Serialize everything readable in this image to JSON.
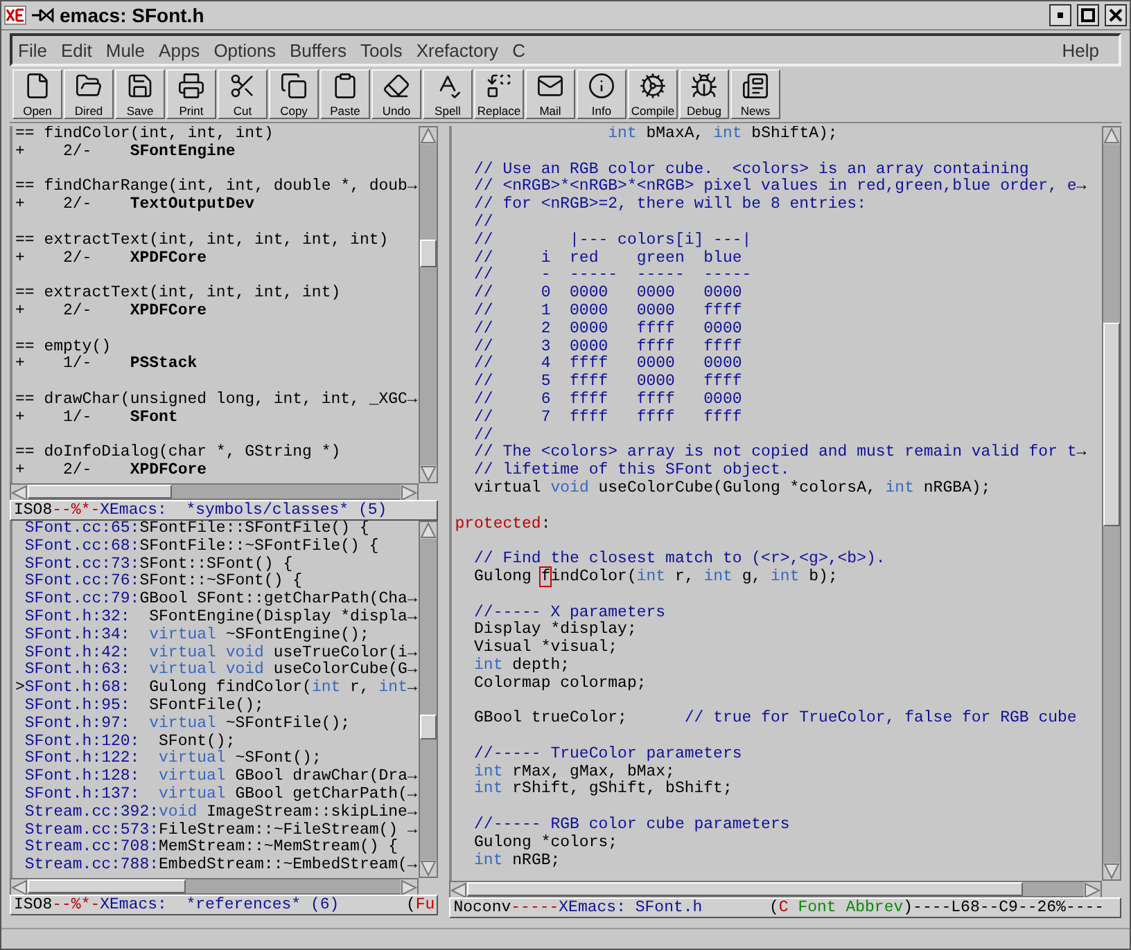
{
  "window": {
    "title": "emacs: SFont.h"
  },
  "menu": {
    "items": [
      "File",
      "Edit",
      "Mule",
      "Apps",
      "Options",
      "Buffers",
      "Tools",
      "Xrefactory",
      "C"
    ],
    "help": "Help"
  },
  "toolbar": [
    "Open",
    "Dired",
    "Save",
    "Print",
    "Cut",
    "Copy",
    "Paste",
    "Undo",
    "Spell",
    "Replace",
    "Mail",
    "Info",
    "Compile",
    "Debug",
    "News"
  ],
  "symbols_pane": {
    "lines": [
      {
        "segs": [
          {
            "text": "== findColor(int, int, int)",
            "kind": "p"
          }
        ]
      },
      {
        "segs": [
          {
            "text": "+    2/-    ",
            "kind": "p"
          },
          {
            "text": "SFontEngine",
            "kind": "b"
          }
        ]
      },
      {
        "space_before": true,
        "segs": [
          {
            "text": "== findCharRange(int, int, double *, doub",
            "kind": "p"
          },
          {
            "text": "→",
            "kind": "a"
          }
        ]
      },
      {
        "segs": [
          {
            "text": "+    2/-    ",
            "kind": "p"
          },
          {
            "text": "TextOutputDev",
            "kind": "b"
          }
        ]
      },
      {
        "space_before": true,
        "segs": [
          {
            "text": "== extractText(int, int, int, int, int)",
            "kind": "p"
          }
        ]
      },
      {
        "segs": [
          {
            "text": "+    2/-    ",
            "kind": "p"
          },
          {
            "text": "XPDFCore",
            "kind": "b"
          }
        ]
      },
      {
        "space_before": true,
        "segs": [
          {
            "text": "== extractText(int, int, int, int)",
            "kind": "p"
          }
        ]
      },
      {
        "segs": [
          {
            "text": "+    2/-    ",
            "kind": "p"
          },
          {
            "text": "XPDFCore",
            "kind": "b"
          }
        ]
      },
      {
        "space_before": true,
        "segs": [
          {
            "text": "== empty()",
            "kind": "p"
          }
        ]
      },
      {
        "segs": [
          {
            "text": "+    1/-    ",
            "kind": "p"
          },
          {
            "text": "PSStack",
            "kind": "b"
          }
        ]
      },
      {
        "space_before": true,
        "segs": [
          {
            "text": "== drawChar(unsigned long, int, int, _XGC",
            "kind": "p"
          },
          {
            "text": "→",
            "kind": "a"
          }
        ]
      },
      {
        "segs": [
          {
            "text": "+    1/-    ",
            "kind": "p"
          },
          {
            "text": "SFont",
            "kind": "b"
          }
        ]
      },
      {
        "space_before": true,
        "segs": [
          {
            "text": "== doInfoDialog(char *, GString *)",
            "kind": "p"
          }
        ]
      },
      {
        "segs": [
          {
            "text": "+    2/-    ",
            "kind": "p"
          },
          {
            "text": "XPDFCore",
            "kind": "b"
          }
        ]
      }
    ],
    "modeline": [
      {
        "text": "ISO8",
        "kind": "p"
      },
      {
        "text": "--%*-",
        "kind": "x"
      },
      {
        "text": "XEmacs:  *symbols/classes* (5)",
        "kind": "m"
      }
    ]
  },
  "references_pane": {
    "lines": [
      {
        "segs": [
          {
            "text": "SFont.cc:65:",
            "kind": "r"
          },
          {
            "text": "SFontFile::SFontFile() {",
            "kind": "p"
          }
        ]
      },
      {
        "segs": [
          {
            "text": "SFont.cc:68:",
            "kind": "r"
          },
          {
            "text": "SFontFile::~SFontFile() {",
            "kind": "p"
          }
        ]
      },
      {
        "segs": [
          {
            "text": "SFont.cc:73:",
            "kind": "r"
          },
          {
            "text": "SFont::SFont() {",
            "kind": "p"
          }
        ]
      },
      {
        "segs": [
          {
            "text": "SFont.cc:76:",
            "kind": "r"
          },
          {
            "text": "SFont::~SFont() {",
            "kind": "p"
          }
        ]
      },
      {
        "segs": [
          {
            "text": "SFont.cc:79:",
            "kind": "r"
          },
          {
            "text": "GBool SFont::getCharPath(Cha",
            "kind": "p"
          },
          {
            "text": "→",
            "kind": "a"
          }
        ]
      },
      {
        "segs": [
          {
            "text": "SFont.h:32:",
            "kind": "r"
          },
          {
            "text": "  SFontEngine(Display *displa",
            "kind": "p"
          },
          {
            "text": "→",
            "kind": "a"
          }
        ]
      },
      {
        "segs": [
          {
            "text": "SFont.h:34:",
            "kind": "r"
          },
          {
            "text": "  virtual",
            "kind": "k"
          },
          {
            "text": " ~SFontEngine();",
            "kind": "p"
          }
        ]
      },
      {
        "segs": [
          {
            "text": "SFont.h:42:",
            "kind": "r"
          },
          {
            "text": "  virtual void",
            "kind": "k"
          },
          {
            "text": " useTrueColor(i",
            "kind": "p"
          },
          {
            "text": "→",
            "kind": "a"
          }
        ]
      },
      {
        "segs": [
          {
            "text": "SFont.h:63:",
            "kind": "r"
          },
          {
            "text": "  virtual void",
            "kind": "k"
          },
          {
            "text": " useColorCube(G",
            "kind": "p"
          },
          {
            "text": "→",
            "kind": "a"
          }
        ]
      },
      {
        "marker": ">",
        "segs": [
          {
            "text": "SFont.h:68:",
            "kind": "r"
          },
          {
            "text": "  Gulong findColor(",
            "kind": "p"
          },
          {
            "text": "int",
            "kind": "k"
          },
          {
            "text": " r, ",
            "kind": "p"
          },
          {
            "text": "int",
            "kind": "k"
          },
          {
            "text": "→",
            "kind": "a"
          }
        ]
      },
      {
        "segs": [
          {
            "text": "SFont.h:95:",
            "kind": "r"
          },
          {
            "text": "  SFontFile();",
            "kind": "p"
          }
        ]
      },
      {
        "segs": [
          {
            "text": "SFont.h:97:",
            "kind": "r"
          },
          {
            "text": "  virtual",
            "kind": "k"
          },
          {
            "text": " ~SFontFile();",
            "kind": "p"
          }
        ]
      },
      {
        "segs": [
          {
            "text": "SFont.h:120:",
            "kind": "r"
          },
          {
            "text": "  SFont();",
            "kind": "p"
          }
        ]
      },
      {
        "segs": [
          {
            "text": "SFont.h:122:",
            "kind": "r"
          },
          {
            "text": "  virtual",
            "kind": "k"
          },
          {
            "text": " ~SFont();",
            "kind": "p"
          }
        ]
      },
      {
        "segs": [
          {
            "text": "SFont.h:128:",
            "kind": "r"
          },
          {
            "text": "  virtual",
            "kind": "k"
          },
          {
            "text": " GBool drawChar(Dra",
            "kind": "p"
          },
          {
            "text": "→",
            "kind": "a"
          }
        ]
      },
      {
        "segs": [
          {
            "text": "SFont.h:137:",
            "kind": "r"
          },
          {
            "text": "  virtual",
            "kind": "k"
          },
          {
            "text": " GBool getCharPath(",
            "kind": "p"
          },
          {
            "text": "→",
            "kind": "a"
          }
        ]
      },
      {
        "segs": [
          {
            "text": "Stream.cc:392:",
            "kind": "r"
          },
          {
            "text": "void",
            "kind": "k"
          },
          {
            "text": " ImageStream::skipLine",
            "kind": "p"
          },
          {
            "text": "→",
            "kind": "a"
          }
        ]
      },
      {
        "segs": [
          {
            "text": "Stream.cc:573:",
            "kind": "r"
          },
          {
            "text": "FileStream::~FileStream() ",
            "kind": "p"
          },
          {
            "text": "→",
            "kind": "a"
          }
        ]
      },
      {
        "segs": [
          {
            "text": "Stream.cc:708:",
            "kind": "r"
          },
          {
            "text": "MemStream::~MemStream() {",
            "kind": "p"
          }
        ]
      },
      {
        "segs": [
          {
            "text": "Stream.cc:788:",
            "kind": "r"
          },
          {
            "text": "EmbedStream::~EmbedStream(",
            "kind": "p"
          },
          {
            "text": "→",
            "kind": "a"
          }
        ]
      }
    ],
    "modeline": [
      {
        "text": "ISO8",
        "kind": "p"
      },
      {
        "text": "--%*-",
        "kind": "x"
      },
      {
        "text": "XEmacs:  *references* (6)",
        "kind": "m"
      },
      {
        "text": "       (",
        "kind": "p"
      },
      {
        "text": "Fu",
        "kind": "x"
      }
    ]
  },
  "editor_pane": {
    "lines": [
      {
        "segs": [
          {
            "text": "                int",
            "kind": "k"
          },
          {
            "text": " bMaxA, ",
            "kind": "p"
          },
          {
            "text": "int",
            "kind": "k"
          },
          {
            "text": " bShiftA);",
            "kind": "p"
          }
        ]
      },
      {
        "space_before": true,
        "segs": [
          {
            "text": "  // Use an RGB color cube.  <colors> is an array containing",
            "kind": "c"
          }
        ]
      },
      {
        "segs": [
          {
            "text": "  // <nRGB>*<nRGB>*<nRGB> pixel values in red,green,blue order, e",
            "kind": "c"
          },
          {
            "text": "→",
            "kind": "a"
          }
        ]
      },
      {
        "segs": [
          {
            "text": "  // for <nRGB>=2, there will be 8 entries:",
            "kind": "c"
          }
        ]
      },
      {
        "segs": [
          {
            "text": "  //",
            "kind": "c"
          }
        ]
      },
      {
        "segs": [
          {
            "text": "  //        |--- colors[i] ---|",
            "kind": "c"
          }
        ]
      },
      {
        "segs": [
          {
            "text": "  //     i  red    green  blue",
            "kind": "c"
          }
        ]
      },
      {
        "segs": [
          {
            "text": "  //     -  -----  -----  -----",
            "kind": "c"
          }
        ]
      },
      {
        "segs": [
          {
            "text": "  //     0  0000   0000   0000",
            "kind": "c"
          }
        ]
      },
      {
        "segs": [
          {
            "text": "  //     1  0000   0000   ffff",
            "kind": "c"
          }
        ]
      },
      {
        "segs": [
          {
            "text": "  //     2  0000   ffff   0000",
            "kind": "c"
          }
        ]
      },
      {
        "segs": [
          {
            "text": "  //     3  0000   ffff   ffff",
            "kind": "c"
          }
        ]
      },
      {
        "segs": [
          {
            "text": "  //     4  ffff   0000   0000",
            "kind": "c"
          }
        ]
      },
      {
        "segs": [
          {
            "text": "  //     5  ffff   0000   ffff",
            "kind": "c"
          }
        ]
      },
      {
        "segs": [
          {
            "text": "  //     6  ffff   ffff   0000",
            "kind": "c"
          }
        ]
      },
      {
        "segs": [
          {
            "text": "  //     7  ffff   ffff   ffff",
            "kind": "c"
          }
        ]
      },
      {
        "segs": [
          {
            "text": "  //",
            "kind": "c"
          }
        ]
      },
      {
        "segs": [
          {
            "text": "  // The <colors> array is not copied and must remain valid for t",
            "kind": "c"
          },
          {
            "text": "→",
            "kind": "a"
          }
        ]
      },
      {
        "segs": [
          {
            "text": "  // lifetime of this SFont object.",
            "kind": "c"
          }
        ]
      },
      {
        "segs": [
          {
            "text": "  virtual ",
            "kind": "p"
          },
          {
            "text": "void",
            "kind": "k"
          },
          {
            "text": " useColorCube(Gulong *colorsA, ",
            "kind": "p"
          },
          {
            "text": "int",
            "kind": "k"
          },
          {
            "text": " nRGBA);",
            "kind": "p"
          }
        ]
      },
      {
        "space_before": true,
        "segs": [
          {
            "text": "protected",
            "kind": "x"
          },
          {
            "text": ":",
            "kind": "p"
          }
        ]
      },
      {
        "space_before": true,
        "segs": [
          {
            "text": "  // Find the closest match to (<r>,<g>,<b>).",
            "kind": "c"
          }
        ]
      },
      {
        "segs": [
          {
            "text": "  Gulong ",
            "kind": "p"
          },
          {
            "text": "f",
            "kind": "cur"
          },
          {
            "text": "indColor(",
            "kind": "p"
          },
          {
            "text": "int",
            "kind": "k"
          },
          {
            "text": " r, ",
            "kind": "p"
          },
          {
            "text": "int",
            "kind": "k"
          },
          {
            "text": " g, ",
            "kind": "p"
          },
          {
            "text": "int",
            "kind": "k"
          },
          {
            "text": " b);",
            "kind": "p"
          }
        ]
      },
      {
        "space_before": true,
        "segs": [
          {
            "text": "  //----- X parameters",
            "kind": "c"
          }
        ]
      },
      {
        "segs": [
          {
            "text": "  Display *display;",
            "kind": "p"
          }
        ]
      },
      {
        "segs": [
          {
            "text": "  Visual *visual;",
            "kind": "p"
          }
        ]
      },
      {
        "segs": [
          {
            "text": "  int",
            "kind": "k"
          },
          {
            "text": " depth;",
            "kind": "p"
          }
        ]
      },
      {
        "segs": [
          {
            "text": "  Colormap colormap;",
            "kind": "p"
          }
        ]
      },
      {
        "space_before": true,
        "segs": [
          {
            "text": "  GBool trueColor;      ",
            "kind": "p"
          },
          {
            "text": "// true for TrueColor, false for RGB cube",
            "kind": "c"
          }
        ]
      },
      {
        "space_before": true,
        "segs": [
          {
            "text": "  //----- TrueColor parameters",
            "kind": "c"
          }
        ]
      },
      {
        "segs": [
          {
            "text": "  int",
            "kind": "k"
          },
          {
            "text": " rMax, gMax, bMax;",
            "kind": "p"
          }
        ]
      },
      {
        "segs": [
          {
            "text": "  int",
            "kind": "k"
          },
          {
            "text": " rShift, gShift, bShift;",
            "kind": "p"
          }
        ]
      },
      {
        "space_before": true,
        "segs": [
          {
            "text": "  //----- RGB color cube parameters",
            "kind": "c"
          }
        ]
      },
      {
        "segs": [
          {
            "text": "  Gulong *colors;",
            "kind": "p"
          }
        ]
      },
      {
        "segs": [
          {
            "text": "  int",
            "kind": "k"
          },
          {
            "text": " nRGB;",
            "kind": "p"
          }
        ]
      }
    ],
    "modeline": [
      {
        "text": "Noconv",
        "kind": "p"
      },
      {
        "text": "-----",
        "kind": "x"
      },
      {
        "text": "XEmacs: SFont.h",
        "kind": "m"
      },
      {
        "text": "       (",
        "kind": "p"
      },
      {
        "text": "C",
        "kind": "x"
      },
      {
        "text": " Font Abbrev",
        "kind": "g"
      },
      {
        "text": ")----L68--C9--26%----",
        "kind": "p"
      }
    ]
  }
}
